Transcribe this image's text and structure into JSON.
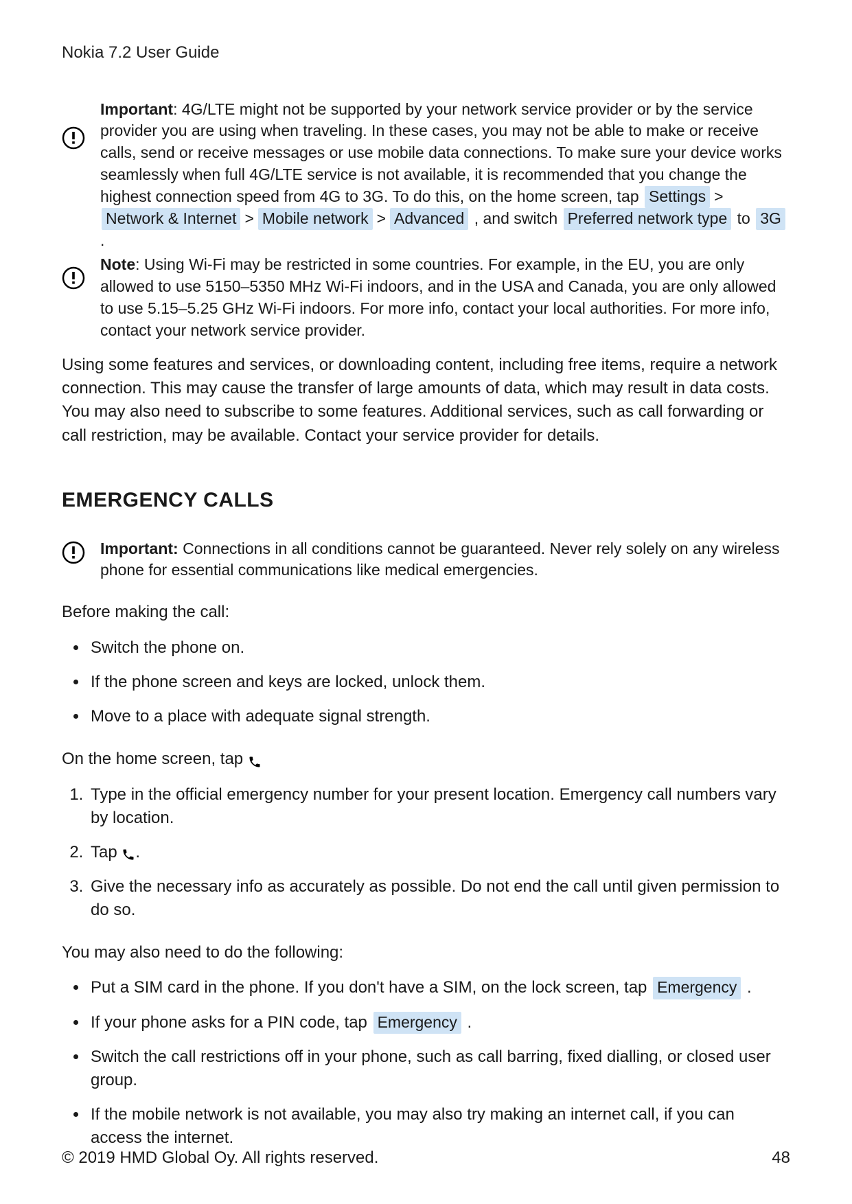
{
  "header": {
    "title": "Nokia 7.2 User Guide"
  },
  "notice1": {
    "label_prefix": "Important",
    "text_before_path": ": 4G/LTE might not be supported by your network service provider or by the service provider you are using when traveling. In these cases, you may not be able to make or receive calls, send or receive messages or use mobile data connections. To make sure your device works seamlessly when full 4G/LTE service is not available, it is recommended that you change the highest connection speed from 4G to 3G. To do this, on the home screen, tap ",
    "path": [
      "Settings",
      "Network & Internet",
      "Mobile network",
      "Advanced"
    ],
    "after_path": " , and switch ",
    "pref_chip": "Preferred network type",
    "to_word": " to ",
    "three_g": "3G",
    "period": " ."
  },
  "notice2": {
    "label_prefix": "Note",
    "text": ": Using Wi-Fi may be restricted in some countries. For example, in the EU, you are only allowed to use 5150–5350 MHz Wi-Fi indoors, and in the USA and Canada, you are only allowed to use 5.15–5.25 GHz Wi-Fi indoors. For more info, contact your local authorities. For more info, contact your network service provider."
  },
  "para1": "Using some features and services, or downloading content, including free items, require a network connection. This may cause the transfer of large amounts of data, which may result in data costs. You may also need to subscribe to some features. Additional services, such as call forwarding or call restriction, may be available. Contact your service provider for details.",
  "section": {
    "heading": "EMERGENCY CALLS"
  },
  "notice3": {
    "label_prefix": "Important:",
    "text": " Connections in all conditions cannot be guaranteed. Never rely solely on any wireless phone for essential communications like medical emergencies."
  },
  "before_call_intro": "Before making the call:",
  "bullets_before": [
    "Switch the phone on.",
    "If the phone screen and keys are locked, unlock them.",
    "Move to a place with adequate signal strength."
  ],
  "home_screen_tap": "On the home screen, tap ",
  "steps": [
    "Type in the official emergency number for your present location. Emergency call numbers vary by location.",
    "Tap ",
    "Give the necessary info as accurately as possible. Do not end the call until given permission to do so."
  ],
  "step2_suffix": ".",
  "also_intro": "You may also need to do the following:",
  "bullets_after": {
    "b1_pre": "Put a SIM card in the phone. If you don't have a SIM, on the lock screen, tap ",
    "b1_chip": "Emergency",
    "b1_post": " .",
    "b2_pre": "If your phone asks for a PIN code, tap ",
    "b2_chip": "Emergency",
    "b2_post": " .",
    "b3": "Switch the call restrictions off in your phone, such as call barring, fixed dialling, or closed user group.",
    "b4": "If the mobile network is not available, you may also try making an internet call, if you can access the internet."
  },
  "footer": {
    "copyright": "© 2019 HMD Global Oy. All rights reserved.",
    "page": "48"
  }
}
